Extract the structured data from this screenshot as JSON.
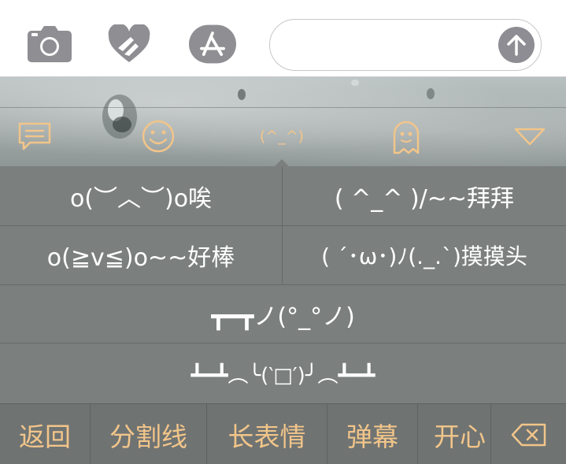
{
  "topbar": {
    "icons": [
      "camera-icon",
      "heart-hands-icon",
      "app-store-icon"
    ],
    "message_input": {
      "value": "",
      "placeholder": ""
    },
    "send_icon": "arrow-up-icon"
  },
  "keyboard": {
    "tabs": [
      {
        "icon": "chat-bubble-icon"
      },
      {
        "icon": "smiley-icon"
      },
      {
        "icon": "kaomoji-icon",
        "label": "(^_^)",
        "active": true
      },
      {
        "icon": "ghost-icon"
      },
      {
        "icon": "triangle-down-icon"
      }
    ],
    "kaomoji": [
      "o(︶︿︶)o唉",
      "( ^_^ )/~~拜拜",
      "o(≧v≦)o~~好棒",
      "( ´･ω･)ﾉ(._.`)摸摸头",
      "┳━┳ノ(°_°ノ)",
      "┻━┻︵╰(‵□′)╯︵┻━┻"
    ],
    "bottom_bar": [
      "返回",
      "分割线",
      "长表情",
      "弹幕",
      "开心"
    ],
    "delete_icon": "backspace-icon"
  },
  "colors": {
    "accent": "#f2c58a",
    "panel": "#7b807f",
    "send": "#8d8d93",
    "icon_gray": "#8e8e93"
  }
}
